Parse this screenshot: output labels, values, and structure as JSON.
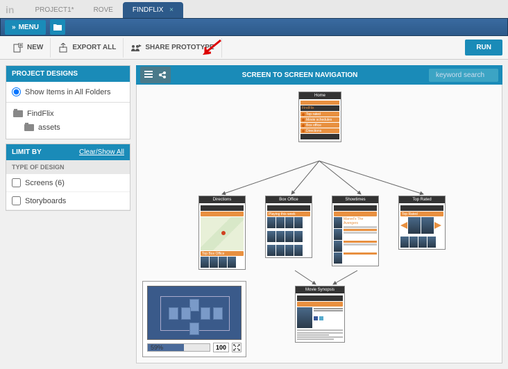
{
  "tabs": {
    "logo": "in",
    "items": [
      "PROJECT1*",
      "ROVE",
      "FINDFLIX"
    ],
    "activeIndex": 2
  },
  "menubar": {
    "menu": "MENU"
  },
  "toolbar": {
    "new": "NEW",
    "exportAll": "EXPORT ALL",
    "share": "SHARE PROTOTYPE",
    "run": "RUN"
  },
  "sidebar": {
    "designsHeader": "PROJECT DESIGNS",
    "showAll": "Show Items in All Folders",
    "tree": {
      "root": "FindFlix",
      "child": "assets"
    },
    "limitHeader": "LIMIT BY",
    "clearLink": "Clear/Show All",
    "typeHeader": "TYPE OF DESIGN",
    "filters": [
      "Screens (6)",
      "Storyboards"
    ]
  },
  "main": {
    "title": "SCREEN TO SCREEN NAVIGATION",
    "searchPlaceholder": "keyword search"
  },
  "nodes": {
    "home": "Home",
    "homeApp": "FindFlix",
    "homeItems": [
      "Top rated",
      "Movie schedules",
      "Box office",
      "Directions"
    ],
    "directions": "Directions",
    "boxOffice": "Box Office",
    "showtimes": "Showtimes",
    "topRated": "Top Rated",
    "synopsis": "Movie Synopsis",
    "movie1": "Marvel's The Avengers",
    "nowPlaying": "Playing this week",
    "topBoxOffice": "Top Box Office",
    "topRatedLabel": "Top Rated"
  },
  "minimap": {
    "zoomPercent": "59%",
    "zoom100": "100"
  }
}
